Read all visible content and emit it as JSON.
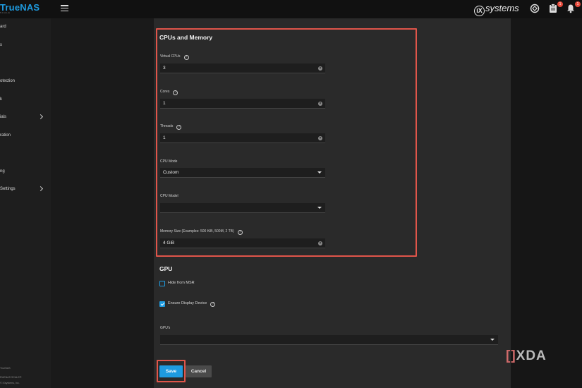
{
  "topbar": {
    "logo": "TrueNAS",
    "logo_sub": "SCALE",
    "brand": "systems",
    "brand_mark": "iX",
    "icons": [
      "menu-icon",
      "truecommand-icon",
      "clipboard-icon",
      "bell-icon"
    ],
    "clipboard_badge": "1",
    "bell_badge": "1"
  },
  "sidebar": {
    "items": [
      {
        "label": "ard"
      },
      {
        "label": "s"
      },
      {
        "label": ""
      },
      {
        "label": "otection"
      },
      {
        "label": "k"
      },
      {
        "label": "ials"
      },
      {
        "label": "ration"
      },
      {
        "label": ""
      },
      {
        "label": "ng"
      },
      {
        "label": " Settings"
      }
    ],
    "footer_lines": [
      "TrueNAS",
      "RUENAS SCALE®",
      "© iXsystems, Inc."
    ]
  },
  "cpu_memory": {
    "title": "CPUs and Memory",
    "vcpus_label": "Virtual CPUs",
    "vcpus_value": "3",
    "cores_label": "Cores",
    "cores_value": "1",
    "threads_label": "Threads",
    "threads_value": "1",
    "cpu_mode_label": "CPU Mode",
    "cpu_mode_value": "Custom",
    "cpu_model_label": "CPU Model",
    "cpu_model_value": "",
    "memory_label": "Memory Size (Examples: 500 KiB, 500M, 2 TB)",
    "memory_value": "4 GiB"
  },
  "gpu": {
    "title": "GPU",
    "hide_msr_label": "Hide from MSR",
    "hide_msr_checked": false,
    "ensure_display_label": "Ensure Display Device",
    "ensure_display_checked": true,
    "gpus_label": "GPU's",
    "gpus_value": ""
  },
  "actions": {
    "save_label": "Save",
    "cancel_label": "Cancel"
  },
  "watermark": {
    "bracket": "[]",
    "text": "XDA"
  },
  "colors": {
    "accent": "#1e9be0",
    "highlight": "#e0554a",
    "badge": "#e74b3c"
  }
}
